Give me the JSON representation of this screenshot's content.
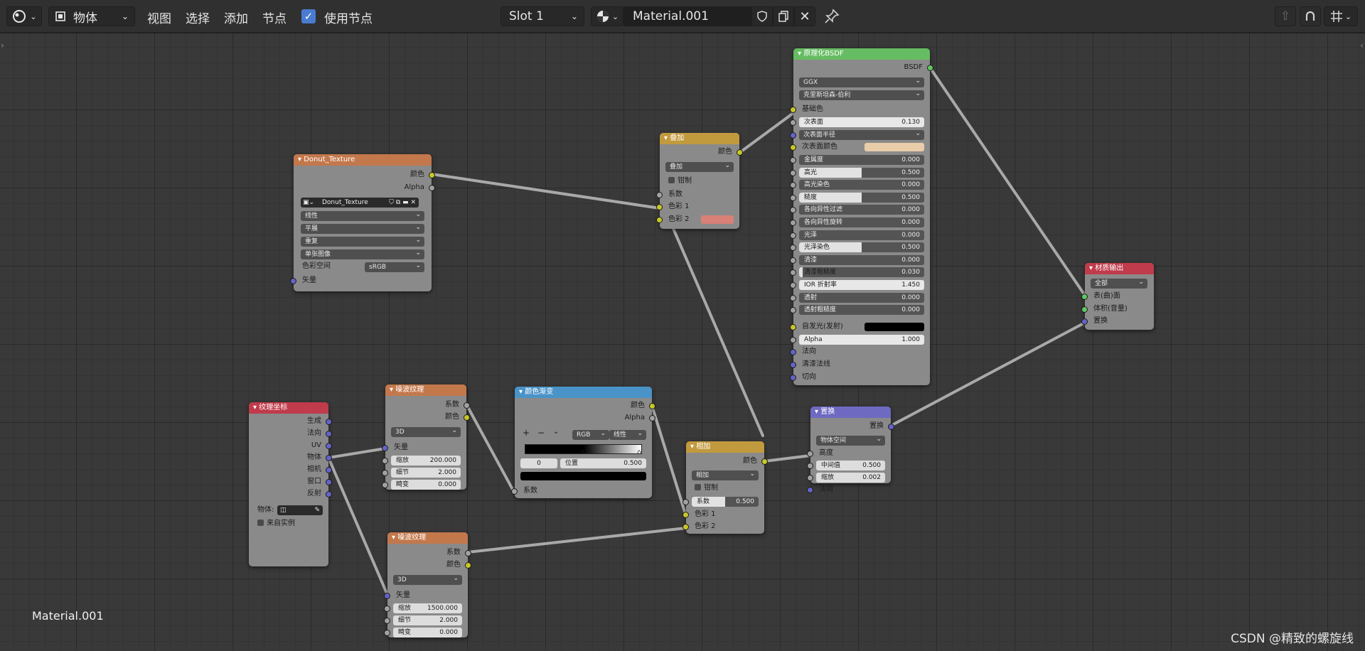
{
  "header": {
    "object_mode": "物体",
    "menus": [
      "视图",
      "选择",
      "添加",
      "节点"
    ],
    "use_nodes_label": "使用节点",
    "slot": "Slot 1",
    "material_name": "Material.001"
  },
  "nodes": {
    "donut_tex": {
      "title": "Donut_Texture",
      "out_color": "颜色",
      "out_alpha": "Alpha",
      "image_name": "Donut_Texture",
      "interp": "线性",
      "proj": "平展",
      "ext": "重复",
      "source": "单张图像",
      "cs_label": "色彩空间",
      "cs_value": "sRGB",
      "in_vector": "矢量"
    },
    "mix": {
      "title": "叠加",
      "out_color": "颜色",
      "blend": "叠加",
      "clamp": "钳制",
      "fac": "系数",
      "c1": "色彩 1",
      "c2": "色彩 2",
      "c2_color": "#d98077"
    },
    "bsdf": {
      "title": "原理化BSDF",
      "out": "BSDF",
      "dist": "GGX",
      "sss_method": "克里斯坦森-伯利",
      "base_color": "基础色",
      "subsurface": {
        "label": "次表面",
        "value": "0.130"
      },
      "sss_radius": "次表面半径",
      "sss_color": {
        "label": "次表面颜色",
        "color": "#e9cda9"
      },
      "fields": [
        {
          "label": "金属度",
          "value": "0.000",
          "fill": 0
        },
        {
          "label": "高光",
          "value": "0.500",
          "fill": 0.5
        },
        {
          "label": "高光染色",
          "value": "0.000",
          "fill": 0
        },
        {
          "label": "糙度",
          "value": "0.500",
          "fill": 0.5
        },
        {
          "label": "各向异性过滤",
          "value": "0.000",
          "fill": 0
        },
        {
          "label": "各向异性旋转",
          "value": "0.000",
          "fill": 0
        },
        {
          "label": "光泽",
          "value": "0.000",
          "fill": 0
        },
        {
          "label": "光泽染色",
          "value": "0.500",
          "fill": 0.5
        },
        {
          "label": "清漆",
          "value": "0.000",
          "fill": 0
        },
        {
          "label": "清漆粗糙度",
          "value": "0.030",
          "fill": 0.03
        },
        {
          "label": "IOR 折射率",
          "value": "1.450",
          "fill": 1
        },
        {
          "label": "透射",
          "value": "0.000",
          "fill": 0
        },
        {
          "label": "透射粗糙度",
          "value": "0.000",
          "fill": 0
        }
      ],
      "emission": {
        "label": "自发光(发射)",
        "color": "#000000"
      },
      "alpha": {
        "label": "Alpha",
        "value": "1.000"
      },
      "normal": "法向",
      "clearcoat_normal": "清漆法线",
      "tangent": "切向"
    },
    "mat_out": {
      "title": "材质输出",
      "target": "全部",
      "surface": "表(曲)面",
      "volume": "体积(音量)",
      "displacement": "置换"
    },
    "tex_coord": {
      "title": "纹理坐标",
      "outputs": [
        "生成",
        "法向",
        "UV",
        "物体",
        "相机",
        "窗口",
        "反射"
      ],
      "object_label": "物体:",
      "from_instancer": "来自实例"
    },
    "noise1": {
      "title": "噪波纹理",
      "out_fac": "系数",
      "out_color": "颜色",
      "dim": "3D",
      "vector": "矢量",
      "fields": [
        {
          "label": "缩放",
          "value": "200.000"
        },
        {
          "label": "细节",
          "value": "2.000"
        },
        {
          "label": "畸变",
          "value": "0.000"
        }
      ]
    },
    "noise2": {
      "title": "噪波纹理",
      "out_fac": "系数",
      "out_color": "颜色",
      "dim": "3D",
      "vector": "矢量",
      "fields": [
        {
          "label": "缩放",
          "value": "1500.000"
        },
        {
          "label": "细节",
          "value": "2.000"
        },
        {
          "label": "畸变",
          "value": "0.000"
        }
      ]
    },
    "ramp": {
      "title": "颜色渐变",
      "out_color": "颜色",
      "out_alpha": "Alpha",
      "color_mode": "RGB",
      "interp": "线性",
      "plus": "+",
      "minus": "−",
      "index": "0",
      "pos_label": "位置",
      "pos_value": "0.500",
      "fac": "系数"
    },
    "add": {
      "title": "相加",
      "out_color": "颜色",
      "blend": "相加",
      "clamp": "钳制",
      "fac": {
        "label": "系数",
        "value": "0.500",
        "fill": 0.5
      },
      "c1": "色彩 1",
      "c2": "色彩 2"
    },
    "disp": {
      "title": "置换",
      "out": "置换",
      "space": "物体空间",
      "height": "高度",
      "midlevel": {
        "label": "中间值",
        "value": "0.500"
      },
      "scale": {
        "label": "缩放",
        "value": "0.002"
      },
      "normal": "法向"
    }
  },
  "footer": {
    "material_label": "Material.001",
    "watermark": "CSDN @精致的螺旋线"
  },
  "colors": {
    "header_tex": "#c3784c",
    "header_color": "#c29a3e",
    "header_shader": "#66bc62",
    "header_output": "#c03b4b",
    "header_input": "#c03b4b",
    "header_convert": "#4a93c8",
    "header_vector": "#6e6ac2"
  }
}
